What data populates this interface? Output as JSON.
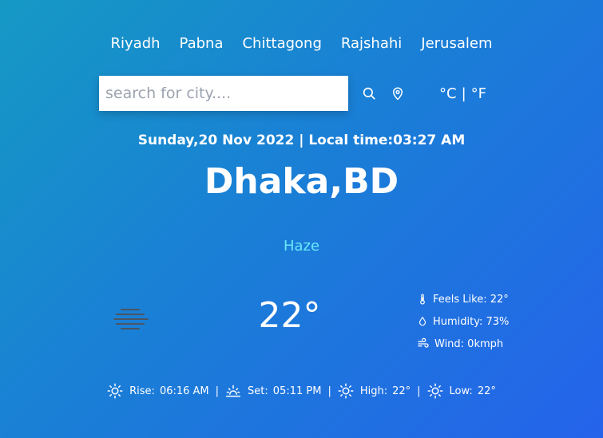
{
  "cities": [
    "Riyadh",
    "Pabna",
    "Chittagong",
    "Rajshahi",
    "Jerusalem"
  ],
  "search": {
    "placeholder": "search for city...."
  },
  "units": {
    "celsius": "°C",
    "separator": "|",
    "fahrenheit": "°F"
  },
  "datetime": "Sunday,20 Nov 2022 | Local time:03:27 AM",
  "city_name": "Dhaka,BD",
  "condition": "Haze",
  "temperature": "22°",
  "details": {
    "feels_like": "Feels Like: 22°",
    "humidity": "Humidity: 73%",
    "wind": "Wind: 0kmph"
  },
  "bottom": {
    "rise_label": "Rise:",
    "rise_value": "06:16 AM",
    "set_label": "Set:",
    "set_value": "05:11 PM",
    "high_label": "High:",
    "high_value": "22°",
    "low_label": "Low:",
    "low_value": "22°",
    "divider": "|"
  },
  "colors": {
    "accent_condition": "#67e8f9",
    "haze_icon": "#4b5563"
  }
}
